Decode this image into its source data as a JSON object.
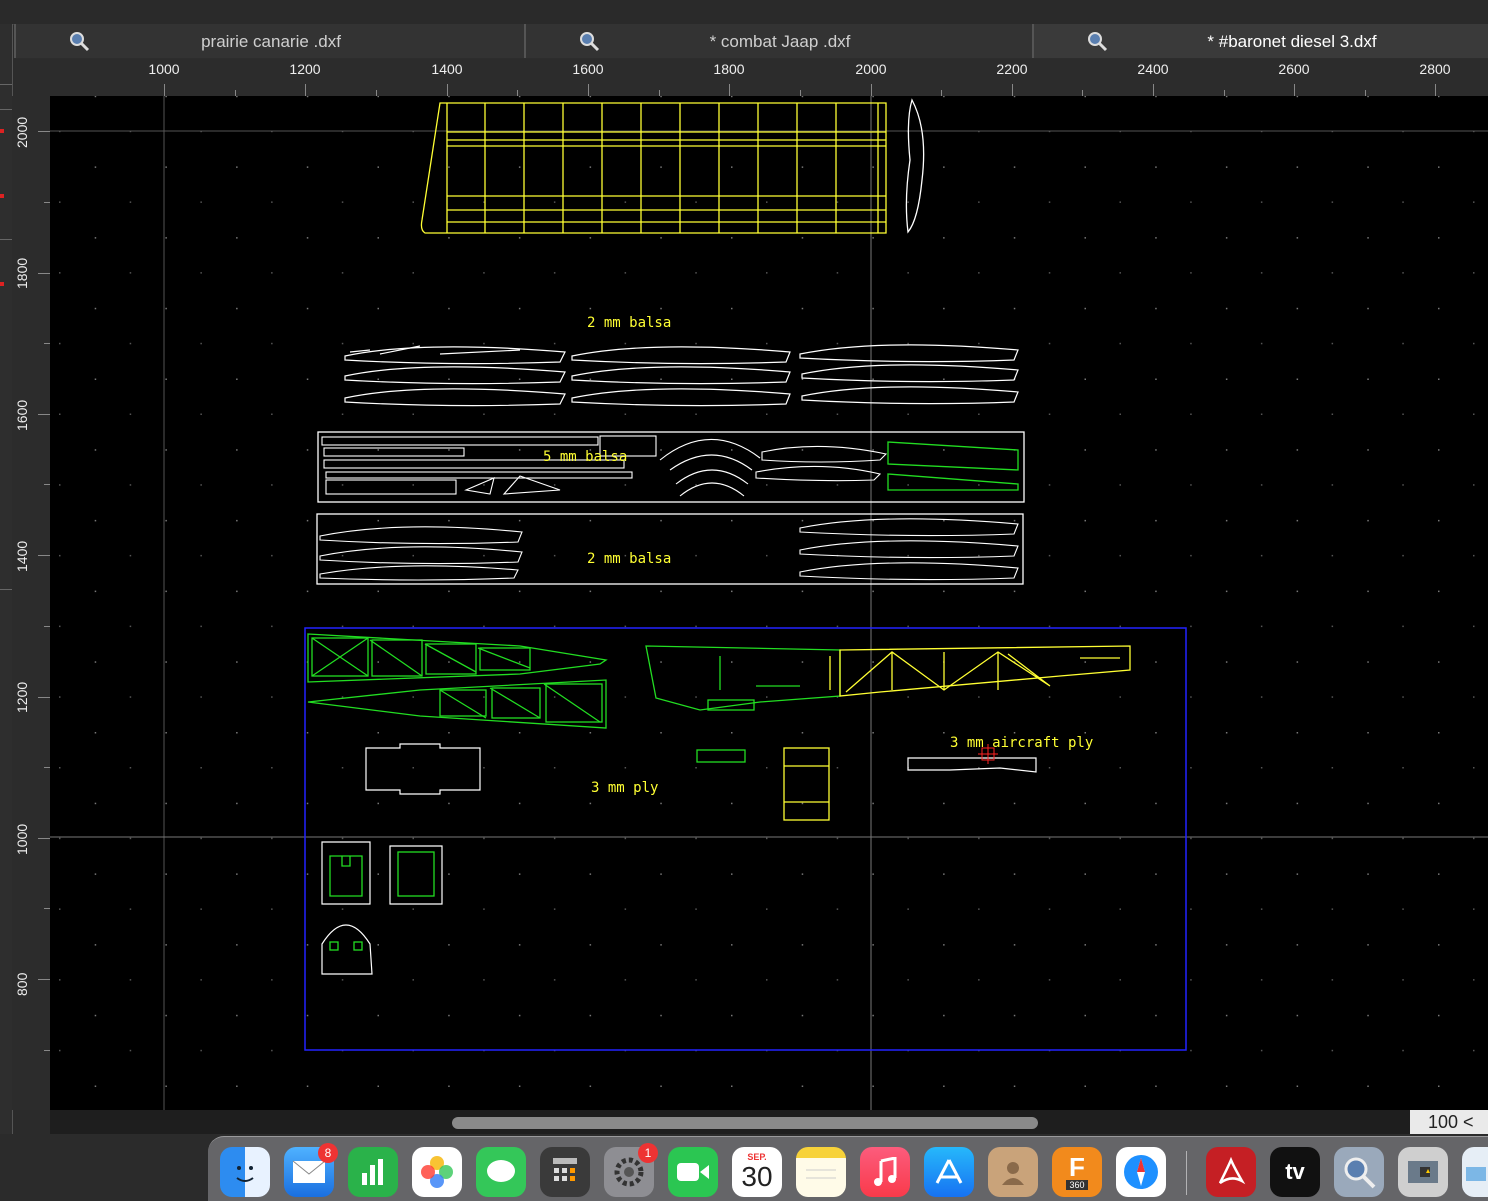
{
  "tabs": [
    {
      "label": "prairie canarie .dxf",
      "active": false
    },
    {
      "label": "* combat  Jaap .dxf",
      "active": false
    },
    {
      "label": "* #baronet diesel 3.dxf",
      "active": true
    }
  ],
  "ruler": {
    "x_labels": [
      "1000",
      "1200",
      "1400",
      "1600",
      "1800",
      "2000",
      "2200",
      "2400",
      "2600",
      "2800"
    ],
    "y_labels": [
      "2000",
      "1800",
      "1600",
      "1400",
      "1200",
      "1000",
      "800"
    ]
  },
  "drawing": {
    "labels": {
      "balsa_2mm_top": "2 mm balsa",
      "balsa_5mm": "5 mm balsa",
      "balsa_2mm_bottom": "2 mm balsa",
      "ply_3mm": "3 mm ply",
      "aircraft_ply_3mm": "3 mm aircraft ply"
    }
  },
  "status": {
    "zoom": "100 <"
  },
  "dock": {
    "apps": [
      {
        "name": "Finder",
        "icon": "finder-icon"
      },
      {
        "name": "Mail",
        "icon": "mail-icon",
        "badge": "8"
      },
      {
        "name": "Numbers",
        "icon": "numbers-icon"
      },
      {
        "name": "Photos",
        "icon": "photos-icon"
      },
      {
        "name": "Messages",
        "icon": "messages-icon"
      },
      {
        "name": "Calculator",
        "icon": "calculator-icon"
      },
      {
        "name": "System Preferences",
        "icon": "gear-icon",
        "badge": "1"
      },
      {
        "name": "FaceTime",
        "icon": "facetime-icon"
      },
      {
        "name": "Calendar",
        "icon": "calendar-icon",
        "month": "SEP.",
        "day": "30"
      },
      {
        "name": "Notes",
        "icon": "notes-icon"
      },
      {
        "name": "Music",
        "icon": "music-icon"
      },
      {
        "name": "App Store",
        "icon": "app-store-icon"
      },
      {
        "name": "Contacts",
        "icon": "contacts-icon"
      },
      {
        "name": "Fusion 360",
        "icon": "fusion-icon",
        "text": "F",
        "subtext": "360"
      },
      {
        "name": "Safari",
        "icon": "safari-icon"
      },
      {
        "name": "Acrobat",
        "icon": "acrobat-icon"
      },
      {
        "name": "Apple TV",
        "icon": "apple-tv-icon",
        "text": "tv"
      },
      {
        "name": "CAD viewer",
        "icon": "cad-magnifier-icon"
      },
      {
        "name": "Image Capture",
        "icon": "image-capture-icon"
      },
      {
        "name": "Preview",
        "icon": "preview-icon"
      }
    ]
  },
  "colors": {
    "yellow": "#ffff33",
    "green": "#22dd22",
    "white": "#ffffff",
    "blue": "#2222ff",
    "red": "#ff2222"
  }
}
